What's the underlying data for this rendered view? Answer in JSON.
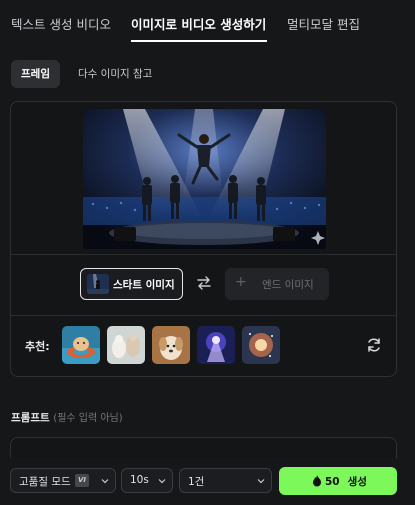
{
  "tabs": [
    {
      "label": "텍스트 생성 비디오",
      "active": false
    },
    {
      "label": "이미지로 비디오 생성하기",
      "active": true
    },
    {
      "label": "멀티모달 편집",
      "active": false
    }
  ],
  "subtabs": {
    "frame": "프레임",
    "multi_ref": "다수 이미지 참고"
  },
  "frames": {
    "start_label": "스타트 이미지",
    "end_label": "엔드 이미지",
    "end_plus": "+"
  },
  "recommend": {
    "label": "추천:",
    "thumbnails": [
      "hamster-float",
      "cats-snow",
      "puppy-popcorn",
      "fantasy-warrior",
      "cosmic-flower"
    ]
  },
  "prompt": {
    "title": "프롬프트",
    "hint": "(필수 입력 아님)"
  },
  "controls": {
    "quality": "고품질 모드",
    "vip": "VI",
    "duration": "10s",
    "count": "1건",
    "credits": "50",
    "generate": "생성"
  },
  "colors": {
    "accent": "#7cf85a",
    "background": "#161719",
    "card_border": "#2e3033"
  }
}
